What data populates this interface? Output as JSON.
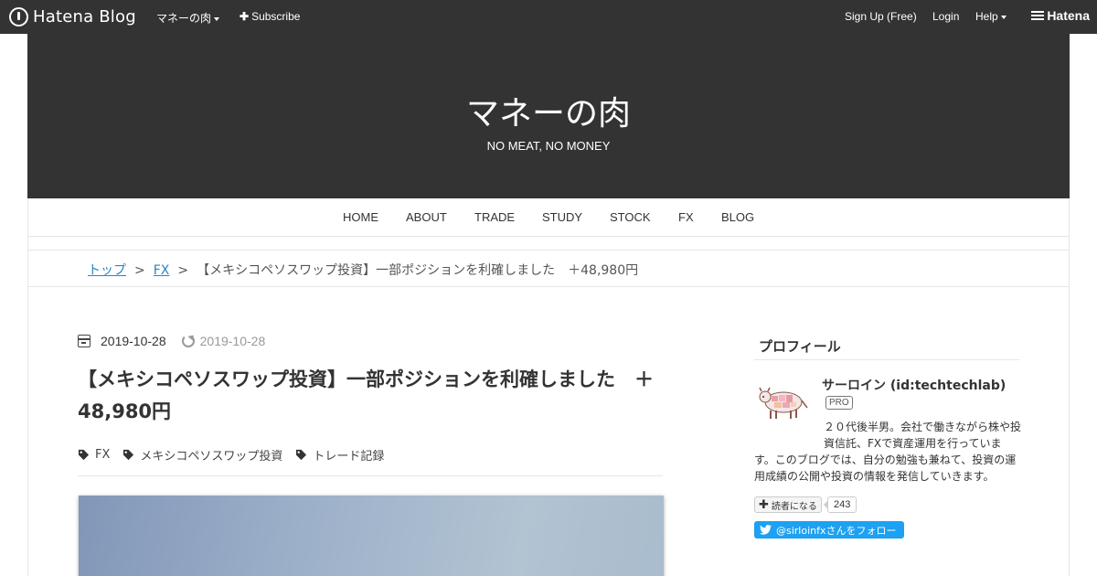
{
  "topbar": {
    "brand": "Hatena Blog",
    "blog_menu": "マネーの肉",
    "subscribe": "Subscribe",
    "signup": "Sign Up (Free)",
    "login": "Login",
    "help": "Help",
    "hatena": "Hatena"
  },
  "blog": {
    "title": "マネーの肉",
    "description": "NO MEAT, NO MONEY"
  },
  "nav": {
    "items": [
      "HOME",
      "ABOUT",
      "TRADE",
      "STUDY",
      "STOCK",
      "FX",
      "BLOG"
    ]
  },
  "breadcrumb": {
    "top": "トップ",
    "sep": ">",
    "category": "FX",
    "current": "【メキシコペソスワップ投資】一部ポジションを利確しました　＋48,980円"
  },
  "entry": {
    "date": "2019-10-28",
    "updated": "2019-10-28",
    "title": "【メキシコペソスワップ投資】一部ポジションを利確しました　＋48,980円",
    "tags": [
      "FX",
      "メキシコペソスワップ投資",
      "トレード記録"
    ]
  },
  "sidebar": {
    "profile_heading": "プロフィール",
    "name": "サーロイン (id:techtechlab)",
    "badge": "PRO",
    "description": "２０代後半男。会社で働きながら株や投資信託、FXで資産運用を行っています。このブログでは、自分の勉強も兼ねて、投資の運用成績の公開や投資の情報を発信していきます。",
    "subscribe_label": "読者になる",
    "subscriber_count": "243",
    "twitter_label": "@sirloinfxさんをフォロー"
  },
  "colors": {
    "header_bg": "#333333",
    "link": "#2a84c5",
    "twitter": "#1da1f2"
  }
}
